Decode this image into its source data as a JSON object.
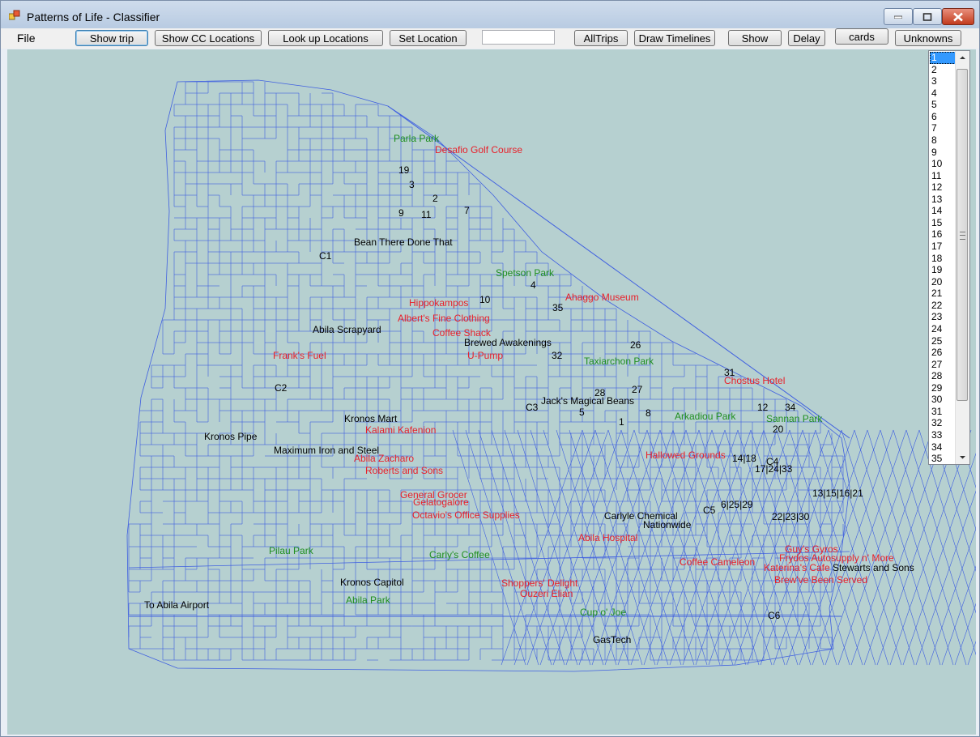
{
  "window": {
    "title": "Patterns of Life - Classifier"
  },
  "menu": {
    "file": "File"
  },
  "toolbar": {
    "show_trip": "Show trip",
    "show_cc_locations": "Show CC Locations",
    "look_up_locations": "Look up Locations",
    "set_location": "Set Location",
    "input_value": "",
    "all_trips": "AllTrips",
    "draw_timelines": "Draw Timelines",
    "show": "Show",
    "delay": "Delay",
    "cards": "cards",
    "unknowns": "Unknowns"
  },
  "map": {
    "colors": {
      "background": "#b6d0d0",
      "roads": "#3f5fe0",
      "business": "#e8202a",
      "park": "#1f8f1f",
      "other": "#000000"
    },
    "labels": {
      "parla_park": "Parla Park",
      "desafio_golf": "Desafio Golf Course",
      "n19": "19",
      "n3": "3",
      "n2": "2",
      "n9": "9",
      "n11": "11",
      "n7": "7",
      "bean_there": "Bean There Done That",
      "c1": "C1",
      "spetson_park": "Spetson Park",
      "n4": "4",
      "hippokampos": "Hippokampos",
      "n10": "10",
      "n35": "35",
      "ahaggo": "Ahaggo Museum",
      "alberts": "Albert's Fine Clothing",
      "abila_scrapyard": "Abila Scrapyard",
      "coffee_shack": "Coffee Shack",
      "brewed_awakenings": "Brewed Awakenings",
      "n26": "26",
      "franks_fuel": "Frank's Fuel",
      "u_pump": "U-Pump",
      "n32": "32",
      "taxiarchon": "Taxiarchon Park",
      "n31": "31",
      "chostus": "Chostus Hotel",
      "c2": "C2",
      "n28": "28",
      "n27": "27",
      "jacks": "Jack's Magical Beans",
      "c3": "C3",
      "n5": "5",
      "n8": "8",
      "n12": "12",
      "n34": "34",
      "arkadiou": "Arkadiou Park",
      "sannan": "Sannan Park",
      "kronos_mart": "Kronos Mart",
      "n1": "1",
      "n20": "20",
      "kalami": "Kalami Kafenion",
      "kronos_pipe": "Kronos Pipe",
      "maximum_iron": "Maximum Iron and Steel",
      "hallowed": "Hallowed Grounds",
      "n14_18": "14|18",
      "c4": "C4",
      "abila_zacharo": "Abila Zacharo",
      "n17_24_33": "17|24|33",
      "roberts": "Roberts and Sons",
      "general_grocer": "General Grocer",
      "gelatogalore": "Gelatogalore",
      "n13_15_16_21": "13|15|16|21",
      "n6_25_29": "6|25|29",
      "c5": "C5",
      "octavios": "Octavio's Office Supplies",
      "carlyle": "Carlyle Chemical",
      "n22_23_30": "22|23|30",
      "nationwide": "Nationwide",
      "abila_hospital": "Abila Hospital",
      "pilau_park": "Pilau Park",
      "carlys_coffee": "Carly's Coffee",
      "guys_gyros": "Guy's Gyros",
      "frydos": "Frydos Autosupply n' More",
      "coffee_cameleon": "Coffee Cameleon",
      "katerinas": "Katerina's Cafe",
      "stewarts": "Stewarts and Sons",
      "kronos_capitol": "Kronos Capitol",
      "shoppers_delight": "Shoppers' Delight",
      "brewve": "Brew've Been Served",
      "ouzeri": "Ouzeri Elian",
      "abila_park": "Abila Park",
      "to_airport": "To Abila Airport",
      "cup_o_joe": "Cup o' Joe",
      "c6": "C6",
      "gastech": "GasTech"
    }
  },
  "list": {
    "items": [
      "1",
      "2",
      "3",
      "4",
      "5",
      "6",
      "7",
      "8",
      "9",
      "10",
      "11",
      "12",
      "13",
      "14",
      "15",
      "16",
      "17",
      "18",
      "19",
      "20",
      "21",
      "22",
      "23",
      "24",
      "25",
      "26",
      "27",
      "28",
      "29",
      "30",
      "31",
      "32",
      "33",
      "34",
      "35"
    ],
    "selected_index": 0
  }
}
